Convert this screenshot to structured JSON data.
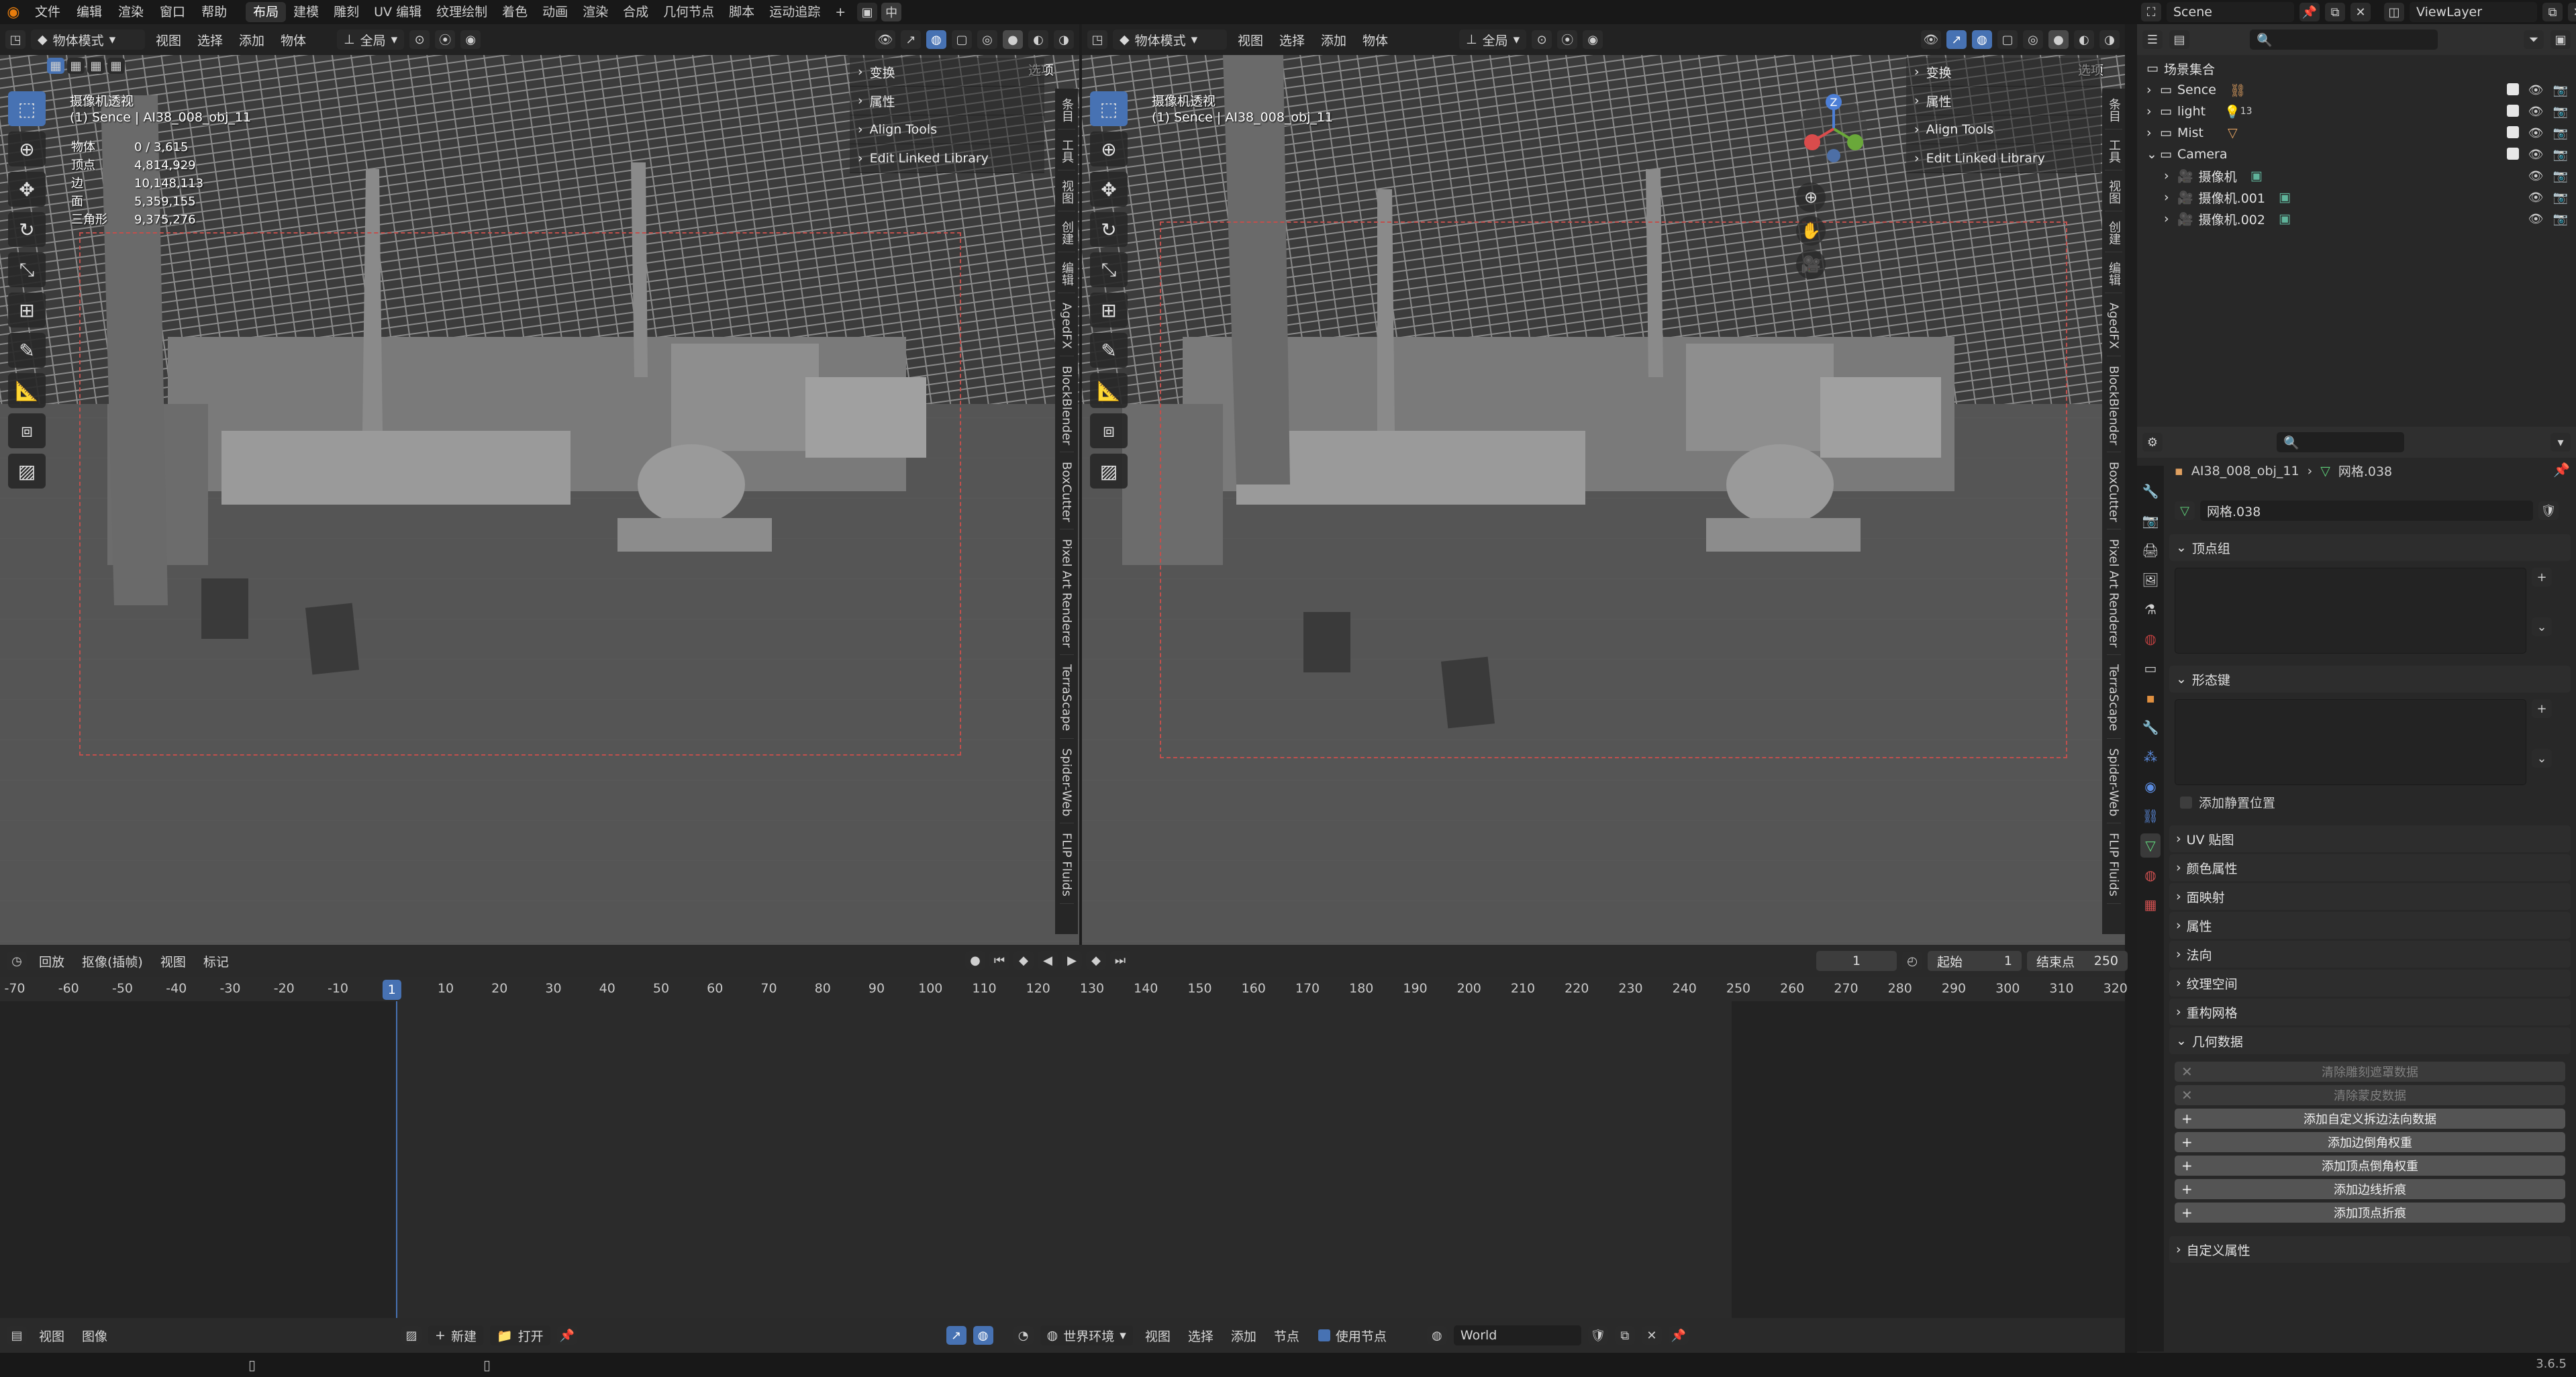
{
  "menu": [
    "文件",
    "编辑",
    "渲染",
    "窗口",
    "帮助"
  ],
  "workspaces": [
    {
      "label": "布局",
      "active": true
    },
    {
      "label": "建模"
    },
    {
      "label": "雕刻"
    },
    {
      "label": "UV 编辑"
    },
    {
      "label": "纹理绘制"
    },
    {
      "label": "着色"
    },
    {
      "label": "动画"
    },
    {
      "label": "渲染"
    },
    {
      "label": "合成"
    },
    {
      "label": "几何节点"
    },
    {
      "label": "脚本"
    },
    {
      "label": "运动追踪"
    }
  ],
  "ime_indicator": "中",
  "scene_name": "Scene",
  "view_layer": "ViewLayer",
  "viewport_left": {
    "mode": "物体模式",
    "menus": [
      "视图",
      "选择",
      "添加",
      "物体"
    ],
    "transform": "全局",
    "options": "选项",
    "overlay_title": "摄像机透视",
    "overlay_sub": "(1) Sence | AI38_008_obj_11",
    "stats": [
      {
        "label": "物体",
        "value": "0 / 3,615"
      },
      {
        "label": "顶点",
        "value": "4,814,929"
      },
      {
        "label": "边",
        "value": "10,148,113"
      },
      {
        "label": "面",
        "value": "5,359,155"
      },
      {
        "label": "三角形",
        "value": "9,375,276"
      }
    ],
    "npanel": [
      "变换",
      "属性",
      "Align Tools",
      "Edit Linked Library"
    ],
    "tabs": [
      "条目",
      "工具",
      "视图",
      "创建",
      "编辑",
      "AgedFX",
      "BlockBlender",
      "BoxCutter",
      "Pixel Art Renderer",
      "TerraScape",
      "Spider-Web",
      "FLIP Fluids"
    ]
  },
  "viewport_right": {
    "mode": "物体模式",
    "menus": [
      "视图",
      "选择",
      "添加",
      "物体"
    ],
    "transform": "全局",
    "options": "选项",
    "overlay_title": "摄像机透视",
    "overlay_sub": "(1) Sence | AI38_008_obj_11",
    "npanel": [
      "变换",
      "属性",
      "Align Tools",
      "Edit Linked Library"
    ],
    "tabs": [
      "条目",
      "工具",
      "视图",
      "创建",
      "编辑",
      "AgedFX",
      "BlockBlender",
      "BoxCutter",
      "Pixel Art Renderer",
      "TerraScape",
      "Spider-Web",
      "FLIP Fluids"
    ],
    "gizmo_axis": "Z"
  },
  "timeline": {
    "menus": [
      "回放",
      "抠像(插帧)",
      "视图",
      "标记"
    ],
    "current_frame": "1",
    "start_label": "起始",
    "start": "1",
    "end_label": "结束点",
    "end": "250",
    "ticks": [
      "-70",
      "-60",
      "-50",
      "-40",
      "-30",
      "-20",
      "-10",
      "1",
      "10",
      "20",
      "30",
      "40",
      "50",
      "60",
      "70",
      "80",
      "90",
      "100",
      "110",
      "120",
      "130",
      "140",
      "150",
      "160",
      "170",
      "180",
      "190",
      "200",
      "210",
      "220",
      "230",
      "240",
      "250",
      "260",
      "270",
      "280",
      "290",
      "300",
      "310",
      "320"
    ]
  },
  "bottom": {
    "left_menus": [
      "视图",
      "图像"
    ],
    "new": "新建",
    "open": "打开",
    "right_menus": [
      "视图",
      "选择",
      "添加",
      "节点"
    ],
    "world_env": "世界环境",
    "use_nodes": "使用节点",
    "world": "World"
  },
  "version": "3.6.5",
  "outliner": {
    "root": "场景集合",
    "items": [
      {
        "label": "Sence",
        "level": 1
      },
      {
        "label": "light",
        "level": 1,
        "badge": "13"
      },
      {
        "label": "Mist",
        "level": 1
      },
      {
        "label": "Camera",
        "level": 1,
        "expanded": true
      },
      {
        "label": "摄像机",
        "level": 2
      },
      {
        "label": "摄像机.001",
        "level": 2
      },
      {
        "label": "摄像机.002",
        "level": 2
      }
    ]
  },
  "properties": {
    "breadcrumb_object": "AI38_008_obj_11",
    "breadcrumb_data": "网格.038",
    "mesh_name": "网格.038",
    "sections": [
      {
        "label": "顶点组",
        "expanded": true
      },
      {
        "label": "形态键",
        "expanded": true
      },
      {
        "label": "UV 贴图"
      },
      {
        "label": "颜色属性"
      },
      {
        "label": "面映射"
      },
      {
        "label": "属性"
      },
      {
        "label": "法向"
      },
      {
        "label": "纹理空间"
      },
      {
        "label": "重构网格"
      },
      {
        "label": "几何数据",
        "expanded": true
      },
      {
        "label": "自定义属性"
      }
    ],
    "shape_key_checkbox": "添加静置位置",
    "geometry_buttons": [
      {
        "label": "清除雕刻遮罩数据",
        "disabled": true
      },
      {
        "label": "清除蒙皮数据",
        "disabled": true
      },
      {
        "label": "添加自定义拆边法向数据"
      },
      {
        "label": "添加边倒角权重"
      },
      {
        "label": "添加顶点倒角权重"
      },
      {
        "label": "添加边线折痕"
      },
      {
        "label": "添加顶点折痕"
      }
    ]
  },
  "colors": {
    "accent": "#4772b3",
    "camera_border": "#c0504d",
    "bg_dark": "#1d1d1d",
    "panel": "#282828"
  }
}
